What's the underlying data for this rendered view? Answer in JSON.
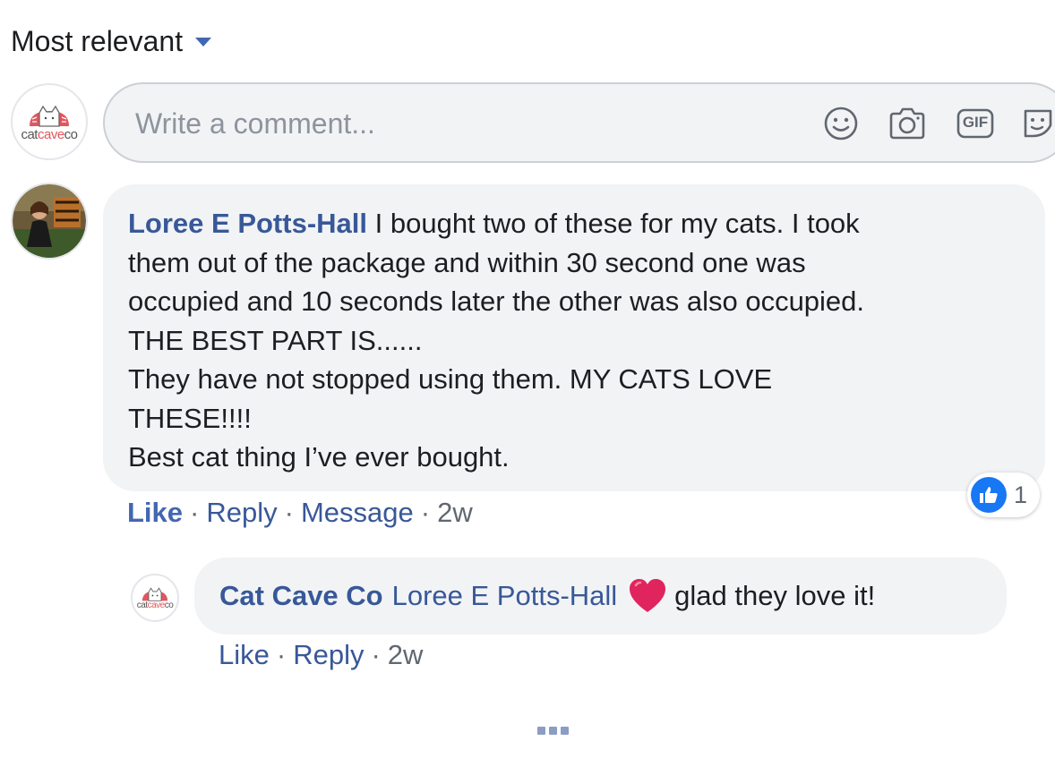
{
  "sort": {
    "label": "Most relevant"
  },
  "brand_logo": {
    "word_cat": "cat",
    "word_cave": "cave",
    "word_co": "co",
    "accent": "#e0565f"
  },
  "composer": {
    "placeholder": "Write a comment...",
    "icons": [
      "emoji-icon",
      "camera-icon",
      "gif-icon",
      "sticker-icon"
    ],
    "gif_label": "GIF"
  },
  "comments": [
    {
      "author": "Loree E Potts-Hall",
      "lines": [
        "I bought two of these for my cats. I took",
        "them out of the package and within 30 second one was",
        "occupied and 10 seconds later the other was also occupied.",
        "THE BEST PART IS......",
        "They have not stopped using them. MY CATS LOVE",
        "THESE!!!!",
        "Best cat thing I’ve ever bought."
      ],
      "actions": {
        "like": "Like",
        "reply": "Reply",
        "message": "Message",
        "time": "2w"
      },
      "reaction": {
        "icon": "thumbs-up-icon",
        "count": "1"
      }
    }
  ],
  "reply": {
    "author": "Cat Cave Co",
    "mention": "Loree E Potts-Hall",
    "emoji": "heart-icon",
    "text": "glad they love it!",
    "actions": {
      "like": "Like",
      "reply": "Reply",
      "time": "2w"
    }
  },
  "more_replies": {
    "icon": "more-dots-icon"
  },
  "colors": {
    "link": "#385898",
    "liked": "#4267b2",
    "bubble": "#f2f3f5",
    "reaction_blue": "#1877f2",
    "heart": "#e0245e"
  }
}
